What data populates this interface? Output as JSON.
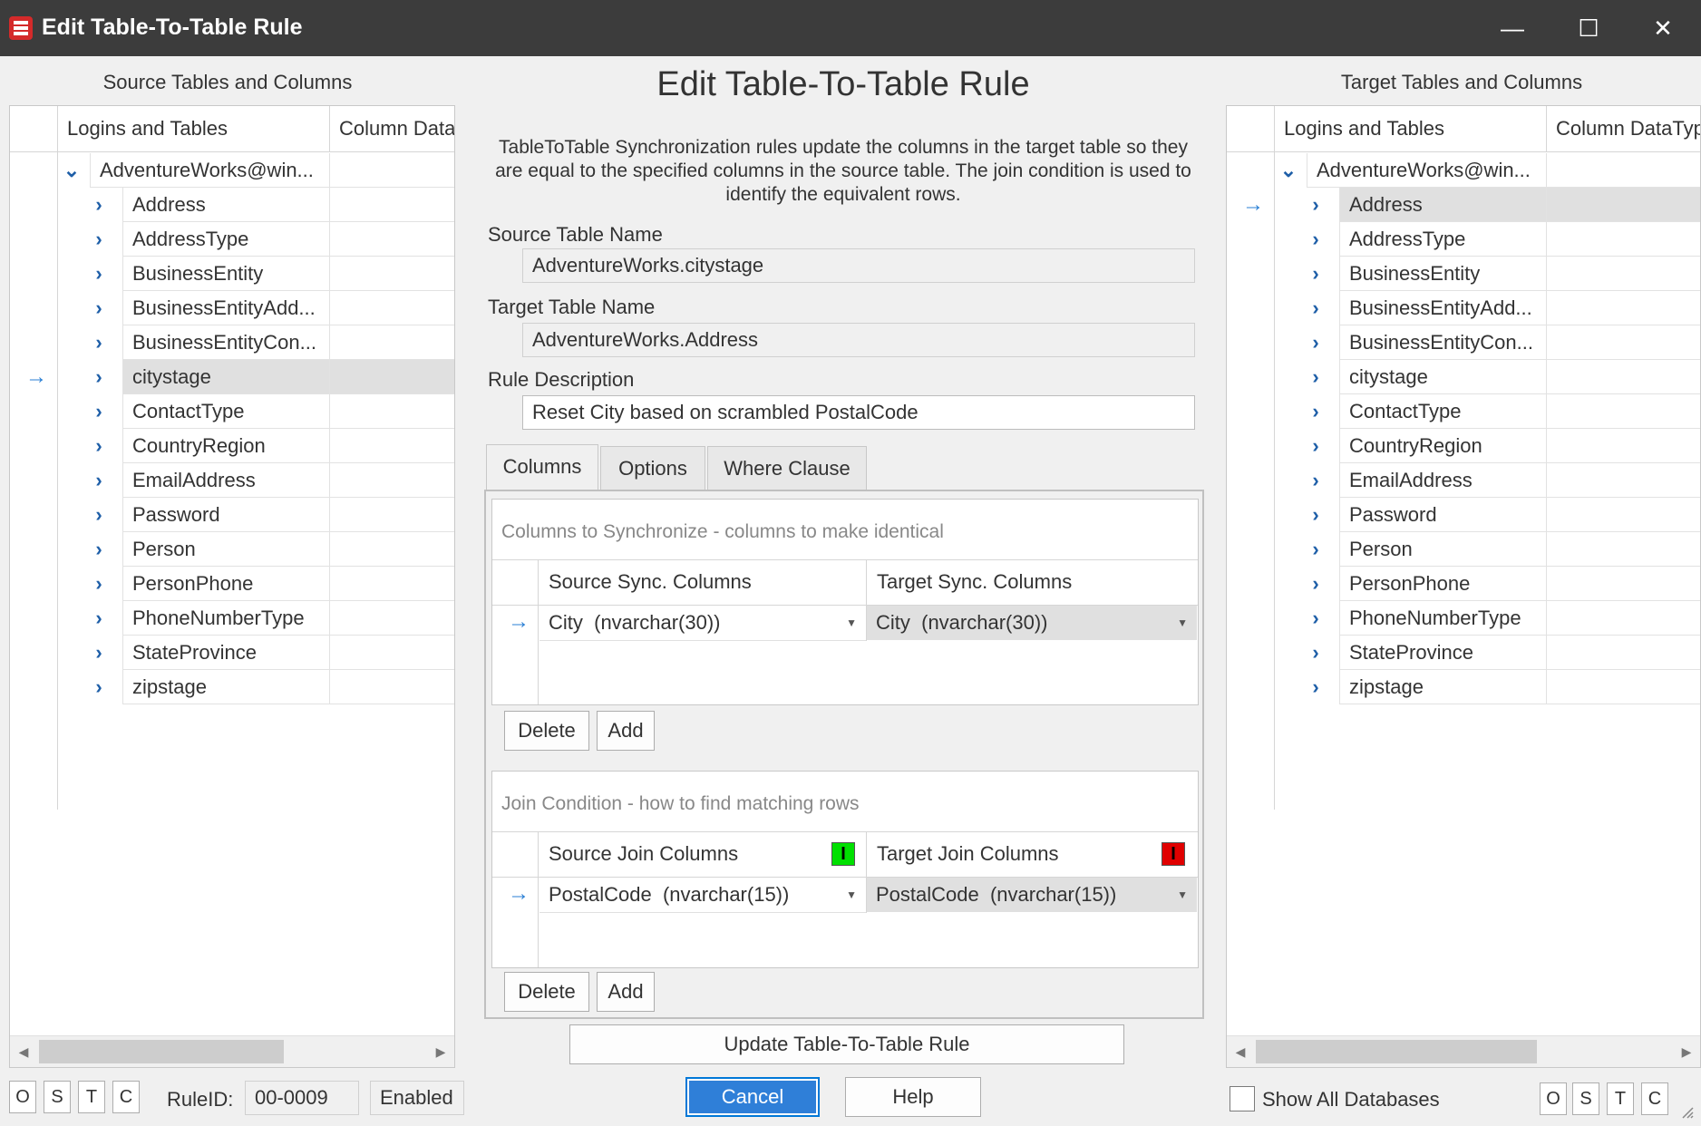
{
  "window": {
    "title": "Edit Table-To-Table Rule",
    "minimize": "—",
    "maximize": "☐",
    "close": "✕"
  },
  "source_panel": {
    "heading": "Source Tables and Columns",
    "col1": "Logins and Tables",
    "col2": "Column DataT",
    "root": "AdventureWorks@win...",
    "items": [
      "Address",
      "AddressType",
      "BusinessEntity",
      "BusinessEntityAdd...",
      "BusinessEntityCon...",
      "citystage",
      "ContactType",
      "CountryRegion",
      "EmailAddress",
      "Password",
      "Person",
      "PersonPhone",
      "PhoneNumberType",
      "StateProvince",
      "zipstage"
    ],
    "selected_index": 5
  },
  "target_panel": {
    "heading": "Target Tables and Columns",
    "col1": "Logins and Tables",
    "col2": "Column DataTyp",
    "root": "AdventureWorks@win...",
    "items": [
      "Address",
      "AddressType",
      "BusinessEntity",
      "BusinessEntityAdd...",
      "BusinessEntityCon...",
      "citystage",
      "ContactType",
      "CountryRegion",
      "EmailAddress",
      "Password",
      "Person",
      "PersonPhone",
      "PhoneNumberType",
      "StateProvince",
      "zipstage"
    ],
    "selected_index": 0
  },
  "center": {
    "title": "Edit Table-To-Table Rule",
    "description": "TableToTable Synchronization rules update the columns in the target table so they are equal to the specified columns in the source table. The join condition is used to identify the equivalent rows.",
    "source_table_label": "Source Table Name",
    "source_table_value": "AdventureWorks.citystage",
    "target_table_label": "Target Table Name",
    "target_table_value": "AdventureWorks.Address",
    "rule_desc_label": "Rule Description",
    "rule_desc_value": "Reset City based on scrambled PostalCode",
    "tabs": [
      "Columns",
      "Options",
      "Where Clause"
    ],
    "sync": {
      "title": "Columns to Synchronize - columns to make identical",
      "col_source": "Source Sync. Columns",
      "col_target": "Target Sync. Columns",
      "row_source": "City  (nvarchar(30))",
      "row_target": "City  (nvarchar(30))",
      "delete": "Delete",
      "add": "Add"
    },
    "join": {
      "title": "Join Condition - how to find matching rows",
      "col_source": "Source Join Columns",
      "col_target": "Target Join Columns",
      "row_source": "PostalCode  (nvarchar(15))",
      "row_target": "PostalCode  (nvarchar(15))",
      "source_badge_color": "#00e000",
      "target_badge_color": "#e00000",
      "badge_glyph": "I",
      "delete": "Delete",
      "add": "Add"
    },
    "update_button": "Update Table-To-Table Rule",
    "cancel_button": "Cancel",
    "help_button": "Help"
  },
  "bottom": {
    "left_buttons": [
      "O",
      "S",
      "T",
      "C"
    ],
    "ruleid_label": "RuleID:",
    "ruleid_value": "00-0009",
    "enabled_value": "Enabled",
    "show_all_label": "Show All Databases",
    "right_buttons": [
      "O",
      "S",
      "T",
      "C"
    ]
  },
  "icons": {
    "row_pointer": "→",
    "expand": "›",
    "collapse": "⌄",
    "dropdown": "▼",
    "scroll_left": "◀",
    "scroll_right": "▶"
  },
  "colors": {
    "titlebar": "#3c3c3c",
    "accent": "#2f7fd8",
    "selected_row": "#e0e0e0"
  }
}
